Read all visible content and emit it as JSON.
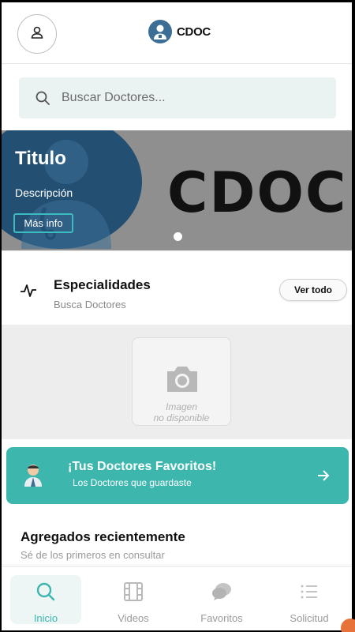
{
  "header": {
    "brand_name": "CDOC"
  },
  "search": {
    "placeholder": "Buscar Doctores..."
  },
  "banner": {
    "title": "Titulo",
    "description": "Descripción",
    "button_label": "Más info",
    "logo_text": "CDOC",
    "active_slide": 1
  },
  "specialties": {
    "title": "Especialidades",
    "subtitle": "Busca Doctores",
    "see_all": "Ver todo",
    "placeholder_line1": "Imagen",
    "placeholder_line2": "no disponible"
  },
  "favorites": {
    "title": "¡Tus Doctores Favoritos!",
    "subtitle": "Los Doctores que guardaste"
  },
  "recent": {
    "title": "Agregados recientemente",
    "subtitle": "Sé de los primeros en consultar"
  },
  "nav": {
    "items": [
      {
        "label": "Inicio",
        "icon": "search-icon",
        "active": true
      },
      {
        "label": "Videos",
        "icon": "film-icon",
        "active": false
      },
      {
        "label": "Favoritos",
        "icon": "chat-bubbles-icon",
        "active": false
      },
      {
        "label": "Solicitud",
        "icon": "list-icon",
        "active": false
      }
    ]
  },
  "colors": {
    "accent": "#3db7ae",
    "brand_blue": "#234f73",
    "search_bg": "#ebf3f2"
  }
}
